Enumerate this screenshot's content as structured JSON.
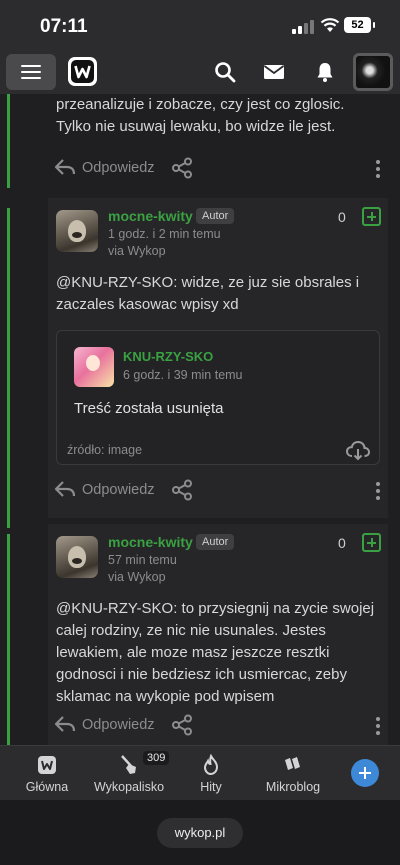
{
  "status": {
    "time": "07:11",
    "battery": "52"
  },
  "header": {
    "icons": [
      "menu-icon",
      "wykop-logo",
      "search-icon",
      "mail-icon",
      "bell-icon",
      "user-avatar"
    ]
  },
  "comments": [
    {
      "text": "przeanalizuje i zobacze, czy jest co zglosic. Tylko nie usuwaj lewaku, bo widze ile jest.",
      "reply_label": "Odpowiedz"
    },
    {
      "author": "mocne-kwity",
      "badge": "Autor",
      "time": "1 godz. i 2 min temu",
      "via": "via Wykop",
      "score": "0",
      "text": "@KNU-RZY-SKO: widze, ze juz sie obsrales i zaczales kasowac wpisy xd",
      "embed": {
        "author": "KNU-RZY-SKO",
        "time": "6 godz. i 39 min temu",
        "text": "Treść została usunięta",
        "source": "źródło: image"
      },
      "reply_label": "Odpowiedz"
    },
    {
      "author": "mocne-kwity",
      "badge": "Autor",
      "time": "57 min temu",
      "via": "via Wykop",
      "score": "0",
      "text": "@KNU-RZY-SKO: to przysiegnij na zycie swojej calej rodziny, ze nic nie usunales. Jestes lewakiem, ale moze masz jeszcze resztki godnosci i nie bedziesz ich usmiercac, zeby sklamac na wykopie pod wpisem",
      "reply_label": "Odpowiedz"
    }
  ],
  "bottom_nav": {
    "items": [
      {
        "label": "Główna",
        "icon": "home-icon"
      },
      {
        "label": "Wykopalisko",
        "icon": "shovel-icon"
      },
      {
        "label": "Hity",
        "icon": "flame-icon"
      },
      {
        "label": "Mikroblog",
        "icon": "microblog-icon"
      }
    ],
    "wykopalisko_count": "309",
    "add_icon": "plus-icon"
  },
  "browser": {
    "url": "wykop.pl"
  }
}
